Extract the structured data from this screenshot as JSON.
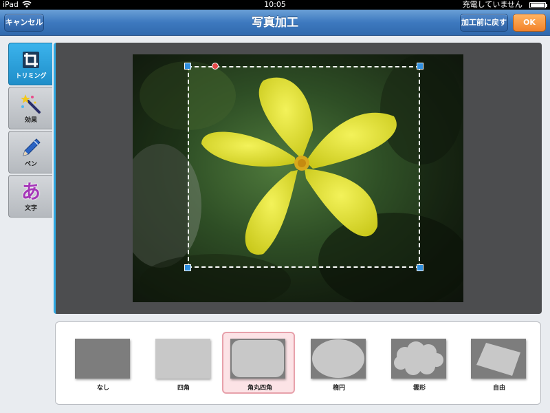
{
  "status": {
    "carrier": "iPad",
    "time": "10:05",
    "charging": "充電していません"
  },
  "nav": {
    "title": "写真加工",
    "cancel": "キャンセル",
    "revert": "加工前に戻す",
    "ok": "OK"
  },
  "tools": [
    {
      "label": "トリミング",
      "icon": "crop-icon",
      "active": true
    },
    {
      "label": "効果",
      "icon": "magic-wand-icon",
      "active": false
    },
    {
      "label": "ペン",
      "icon": "pen-icon",
      "active": false
    },
    {
      "label": "文字",
      "icon": "hiragana-a-icon",
      "glyph": "あ",
      "active": false
    }
  ],
  "shapes": [
    {
      "label": "なし",
      "selected": false
    },
    {
      "label": "四角",
      "selected": false
    },
    {
      "label": "角丸四角",
      "selected": true
    },
    {
      "label": "楕円",
      "selected": false
    },
    {
      "label": "雲形",
      "selected": false
    },
    {
      "label": "自由",
      "selected": false
    }
  ],
  "colors": {
    "nav": "#3d79bf",
    "accent": "#2fa9e3",
    "ok": "#f2822a",
    "handle": "#3090e0",
    "selected_bg": "#fce3e6"
  }
}
